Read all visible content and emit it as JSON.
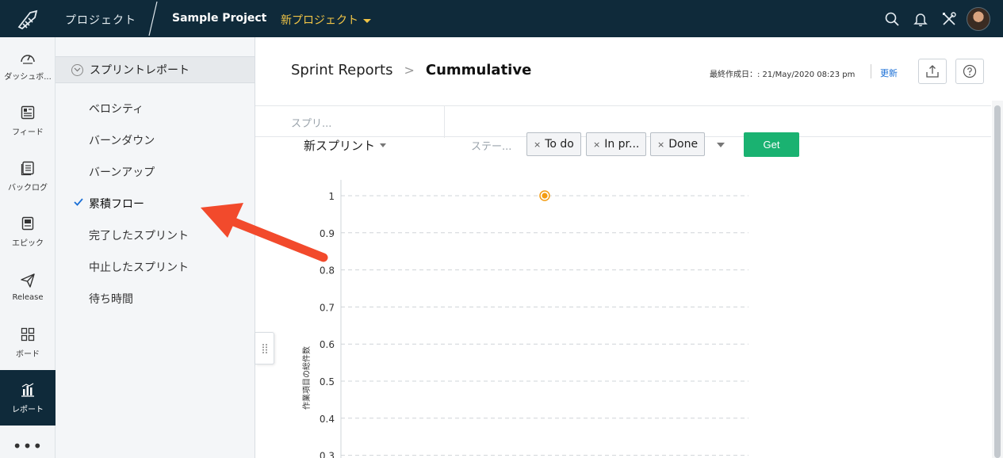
{
  "topbar": {
    "projects_label": "プロジェクト",
    "project_name": "Sample Project",
    "new_project_label": "新プロジェクト"
  },
  "leftnav": {
    "items": [
      {
        "label": "ダッシュボ...",
        "icon": "dashboard-icon"
      },
      {
        "label": "フィード",
        "icon": "feed-icon"
      },
      {
        "label": "バックログ",
        "icon": "backlog-icon"
      },
      {
        "label": "エピック",
        "icon": "epic-icon"
      },
      {
        "label": "Release",
        "icon": "release-icon"
      },
      {
        "label": "ボード",
        "icon": "board-icon"
      },
      {
        "label": "レポート",
        "icon": "report-icon"
      }
    ],
    "more": "•••"
  },
  "sidebar": {
    "header": "スプリントレポート",
    "items": [
      {
        "label": "ベロシティ"
      },
      {
        "label": "バーンダウン"
      },
      {
        "label": "バーンアップ"
      },
      {
        "label": "累積フロー"
      },
      {
        "label": "完了したスプリント"
      },
      {
        "label": "中止したスプリント"
      },
      {
        "label": "待ち時間"
      }
    ]
  },
  "main": {
    "breadcrumb": {
      "root": "Sprint Reports",
      "separator": ">",
      "current": "Cummulative"
    },
    "last_created": "最終作成日：: 21/May/2020 08:23 pm",
    "refresh_label": "更新",
    "filters": {
      "sprint_placeholder": "スプリ...",
      "sprint_selected": "新スプリント",
      "status_placeholder": "ステー...",
      "chips": [
        "To do",
        "In pr...",
        "Done"
      ],
      "chip_remove": "×",
      "get_label": "Get"
    }
  },
  "chart_data": {
    "type": "scatter",
    "ylabel": "作業項目の総件数",
    "yticks": [
      "1",
      "0.9",
      "0.8",
      "0.7",
      "0.6",
      "0.5",
      "0.4",
      "0.3"
    ],
    "points": [
      {
        "x": 0.5,
        "y": 1
      }
    ],
    "point_color": "#f39c12",
    "grid": "dashed-horizontal"
  }
}
